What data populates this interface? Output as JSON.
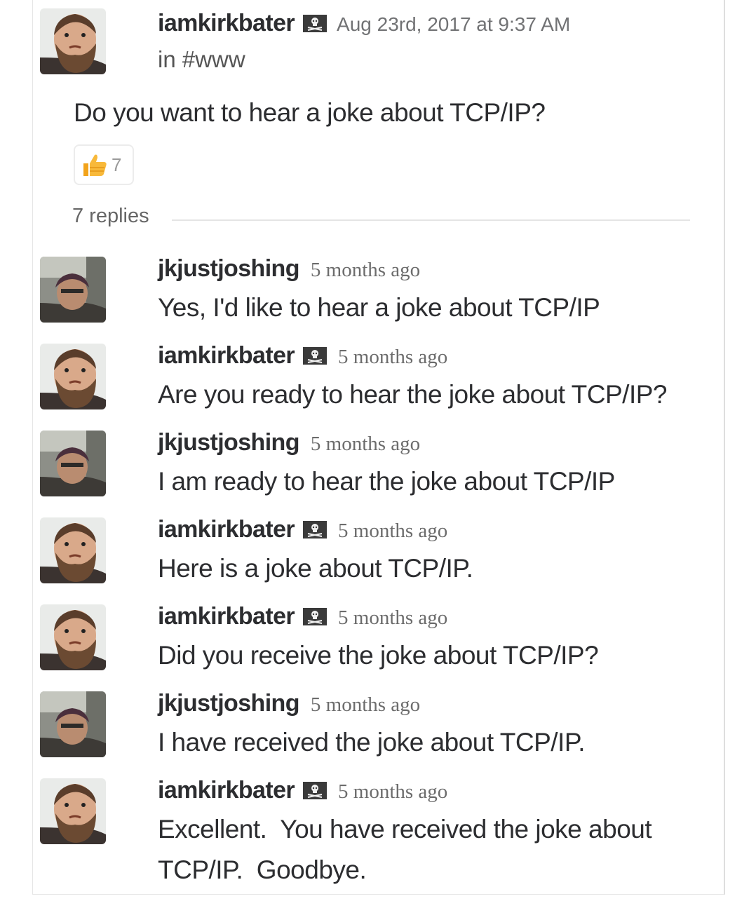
{
  "parent": {
    "username": "iamkirkbater",
    "badge": "pirate-flag-icon",
    "timestamp": "Aug 23rd, 2017 at 9:37 AM",
    "channel": "in #www",
    "text": "Do you want to hear a joke about TCP/IP?",
    "reaction": {
      "emoji": "thumbs-up-icon",
      "count": "7"
    }
  },
  "thread": {
    "replies_label": "7 replies",
    "replies": [
      {
        "username": "jkjustjoshing",
        "badge": "",
        "timestamp": "5 months ago",
        "text": "Yes, I'd like to hear a joke about TCP/IP"
      },
      {
        "username": "iamkirkbater",
        "badge": "pirate-flag-icon",
        "timestamp": "5 months ago",
        "text": "Are you ready to hear the joke about TCP/IP?"
      },
      {
        "username": "jkjustjoshing",
        "badge": "",
        "timestamp": "5 months ago",
        "text": "I am ready to hear the joke about TCP/IP"
      },
      {
        "username": "iamkirkbater",
        "badge": "pirate-flag-icon",
        "timestamp": "5 months ago",
        "text": "Here is a joke about TCP/IP."
      },
      {
        "username": "iamkirkbater",
        "badge": "pirate-flag-icon",
        "timestamp": "5 months ago",
        "text": "Did you receive the joke about TCP/IP?"
      },
      {
        "username": "jkjustjoshing",
        "badge": "",
        "timestamp": "5 months ago",
        "text": "I have received the joke about TCP/IP."
      },
      {
        "username": "iamkirkbater",
        "badge": "pirate-flag-icon",
        "timestamp": "5 months ago",
        "text_line1": "Excellent.  You have received the joke about",
        "text_line2": "TCP/IP.  Goodbye."
      }
    ]
  }
}
